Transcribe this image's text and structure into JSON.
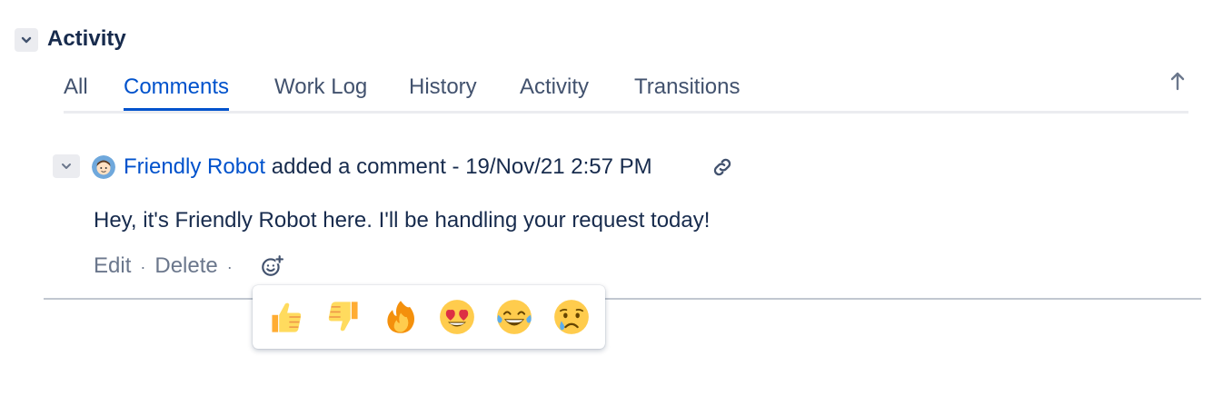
{
  "section": {
    "title": "Activity"
  },
  "tabs": [
    {
      "label": "All",
      "active": false
    },
    {
      "label": "Comments",
      "active": true
    },
    {
      "label": "Work Log",
      "active": false
    },
    {
      "label": "History",
      "active": false
    },
    {
      "label": "Activity",
      "active": false
    },
    {
      "label": "Transitions",
      "active": false
    }
  ],
  "comment": {
    "author": "Friendly Robot",
    "action_text": " added a comment - 19/Nov/21 2:57 PM",
    "body": "Hey, it's Friendly Robot here. I'll be handling your request today!",
    "actions": {
      "edit": "Edit",
      "delete": "Delete",
      "separator": "·"
    }
  },
  "reactions": [
    {
      "name": "thumbs-up",
      "glyph": "👍"
    },
    {
      "name": "thumbs-down",
      "glyph": "👎"
    },
    {
      "name": "fire",
      "glyph": "🔥"
    },
    {
      "name": "heart-eyes",
      "glyph": "😍"
    },
    {
      "name": "tears-of-joy",
      "glyph": "😂"
    },
    {
      "name": "crying",
      "glyph": "😢"
    }
  ],
  "colors": {
    "link": "#0052cc",
    "text": "#172b4d",
    "muted": "#6b778c"
  }
}
